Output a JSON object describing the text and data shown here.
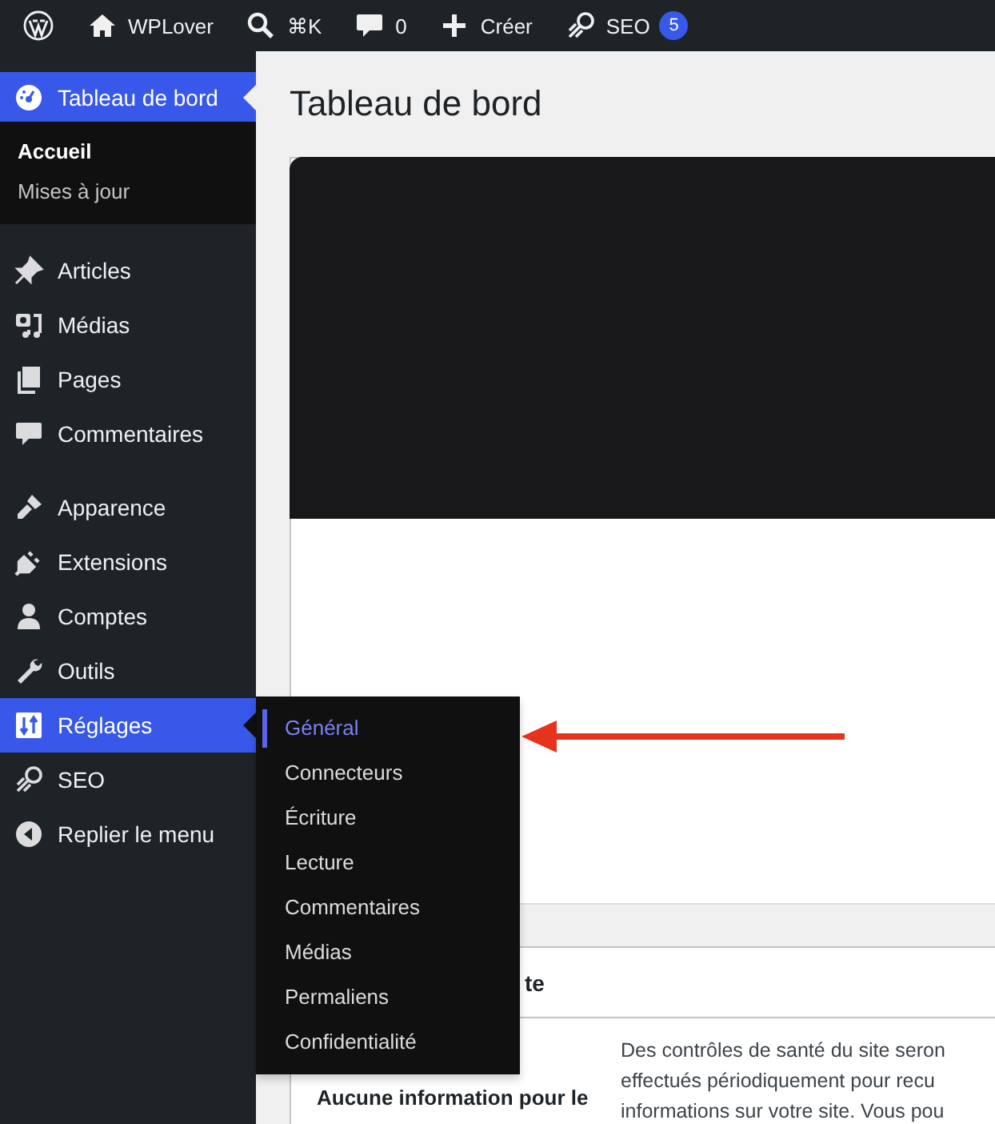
{
  "admin_bar": {
    "items": [
      {
        "kind": "logo"
      },
      {
        "kind": "site",
        "label": "WPLover"
      },
      {
        "kind": "search",
        "label": "⌘K"
      },
      {
        "kind": "comments",
        "label": "0"
      },
      {
        "kind": "new",
        "label": "Créer"
      },
      {
        "kind": "seo",
        "label": "SEO",
        "badge": "5"
      }
    ]
  },
  "sidebar": {
    "groups": [
      {
        "items": [
          {
            "kind": "dashboard",
            "label": "Tableau de bord",
            "selected": true,
            "children": [
              {
                "label": "Accueil",
                "selected": true
              },
              {
                "label": "Mises à jour",
                "selected": false
              }
            ]
          }
        ]
      },
      {
        "items": [
          {
            "kind": "pin",
            "label": "Articles",
            "selected": false
          },
          {
            "kind": "media",
            "label": "Médias",
            "selected": false
          },
          {
            "kind": "pages",
            "label": "Pages",
            "selected": false
          },
          {
            "kind": "comment",
            "label": "Commentaires",
            "selected": false
          }
        ]
      },
      {
        "items": [
          {
            "kind": "brush",
            "label": "Apparence",
            "selected": false
          },
          {
            "kind": "plug",
            "label": "Extensions",
            "selected": false
          },
          {
            "kind": "user",
            "label": "Comptes",
            "selected": false
          },
          {
            "kind": "wrench",
            "label": "Outils",
            "selected": false
          },
          {
            "kind": "sliders",
            "label": "Réglages",
            "selected": true,
            "flyout": [
              {
                "label": "Général",
                "selected": true
              },
              {
                "label": "Connecteurs",
                "selected": false
              },
              {
                "label": "Écriture",
                "selected": false
              },
              {
                "label": "Lecture",
                "selected": false
              },
              {
                "label": "Commentaires",
                "selected": false
              },
              {
                "label": "Médias",
                "selected": false
              },
              {
                "label": "Permaliens",
                "selected": false
              },
              {
                "label": "Confidentialité",
                "selected": false
              }
            ]
          },
          {
            "kind": "seo",
            "label": "SEO",
            "selected": false
          },
          {
            "kind": "collapse",
            "label": "Replier le menu",
            "selected": false
          }
        ]
      }
    ]
  },
  "main": {
    "title": "Tableau de bord",
    "site_health": {
      "heading": "te",
      "label": "Aucune information pour le",
      "description_lines": [
        "Des contrôles de santé du site seron",
        "effectués périodiquement pour recu",
        "informations sur votre site. Vous pou"
      ]
    }
  }
}
